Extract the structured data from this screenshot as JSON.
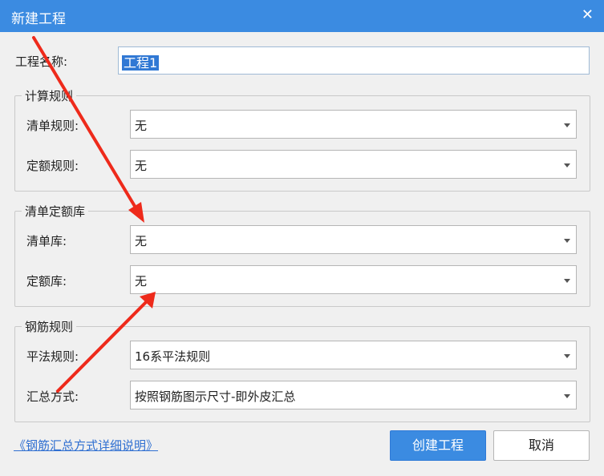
{
  "window": {
    "title": "新建工程",
    "close_symbol": "✕"
  },
  "project": {
    "name_label": "工程名称:",
    "name_value": "工程1"
  },
  "groups": {
    "calc_rules": {
      "title": "计算规则",
      "list_rule_label": "清单规则:",
      "list_rule_value": "无",
      "quota_rule_label": "定额规则:",
      "quota_rule_value": "无"
    },
    "libraries": {
      "title": "清单定额库",
      "list_lib_label": "清单库:",
      "list_lib_value": "无",
      "quota_lib_label": "定额库:",
      "quota_lib_value": "无"
    },
    "rebar_rules": {
      "title": "钢筋规则",
      "flat_rule_label": "平法规则:",
      "flat_rule_value": "16系平法规则",
      "summary_label": "汇总方式:",
      "summary_value": "按照钢筋图示尺寸-即外皮汇总"
    }
  },
  "footer": {
    "help_link": "《钢筋汇总方式详细说明》",
    "create_button": "创建工程",
    "cancel_button": "取消"
  },
  "colors": {
    "titlebar": "#3b8be1",
    "primary_button": "#3b8be1",
    "selection": "#3078d4",
    "annotation_arrow": "#ee2a1b"
  },
  "icons": [
    "close-icon",
    "dropdown-arrow-icon"
  ]
}
